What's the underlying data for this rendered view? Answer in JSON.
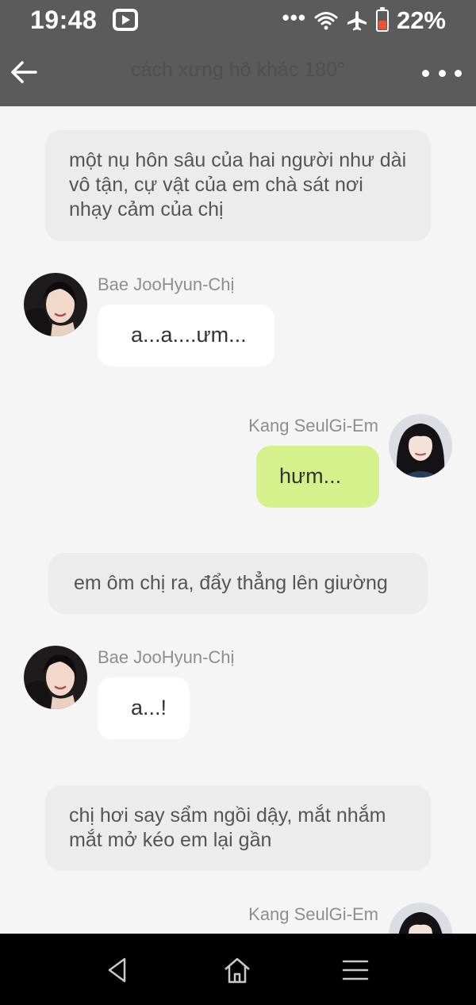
{
  "status_bar": {
    "time": "19:48",
    "dots": "•••",
    "battery_percent": "22%",
    "battery_level": 0.22,
    "battery_color": "#e8542f",
    "icons": [
      "youtube-icon",
      "wifi-icon",
      "airplane-mode-icon",
      "battery-low-icon"
    ]
  },
  "app_bar": {
    "title": "cách xưng hô khác 180°",
    "back_icon": "arrow-left-icon",
    "more_icon": "more-horizontal-icon"
  },
  "messages": [
    {
      "type": "narration",
      "text": "một nụ hôn sâu của hai người như dài vô tận, cự vật của em chà sát nơi nhạy cảm của chị"
    },
    {
      "type": "left",
      "sender": "Bae JooHyun-Chị",
      "text": "a...a....ưm..."
    },
    {
      "type": "right",
      "sender": "Kang SeulGi-Em",
      "text": "hưm..."
    },
    {
      "type": "narration",
      "text": "em ôm chị ra, đẩy thẳng lên giường"
    },
    {
      "type": "left",
      "sender": "Bae JooHyun-Chị",
      "text": "a...!"
    },
    {
      "type": "narration",
      "text": "chị hơi say sẩm ngồi dậy, mắt nhắm mắt mở kéo em lại gần"
    },
    {
      "type": "right",
      "sender": "Kang SeulGi-Em",
      "text": ""
    }
  ],
  "colors": {
    "app_bar": "#5b5b5b",
    "chat_background": "#f5f5f5",
    "narration_bubble": "#ececec",
    "left_bubble": "#ffffff",
    "right_bubble": "#d6f08c",
    "nav_bar": "#000000"
  },
  "nav_bar": {
    "icons": [
      "back-triangle-icon",
      "home-icon",
      "menu-icon"
    ]
  }
}
